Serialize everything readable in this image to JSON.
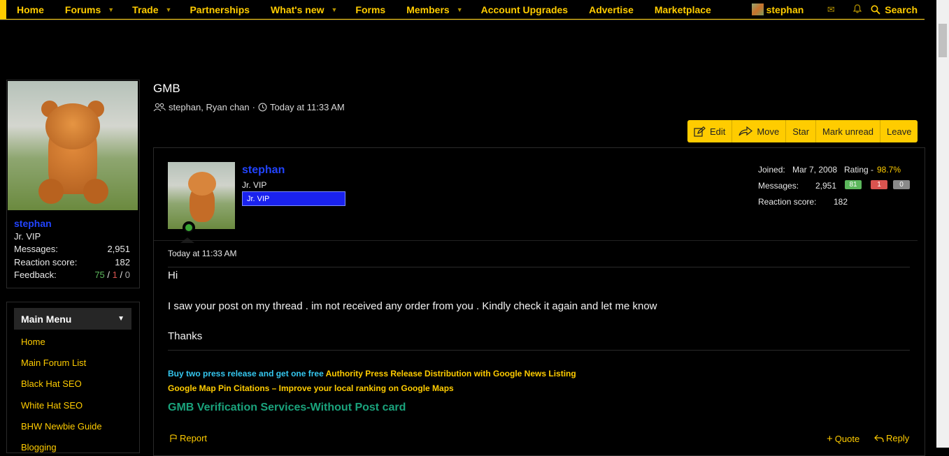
{
  "nav": {
    "items": [
      {
        "label": "Home",
        "caret": false
      },
      {
        "label": "Forums",
        "caret": true
      },
      {
        "label": "Trade",
        "caret": true
      },
      {
        "label": "Partnerships",
        "caret": false
      },
      {
        "label": "What's new",
        "caret": true
      },
      {
        "label": "Forms",
        "caret": false
      },
      {
        "label": "Members",
        "caret": true
      },
      {
        "label": "Account Upgrades",
        "caret": false
      },
      {
        "label": "Advertise",
        "caret": false
      },
      {
        "label": "Marketplace",
        "caret": false
      }
    ],
    "username": "stephan",
    "search_label": "Search"
  },
  "sidebar": {
    "user": {
      "name": "stephan",
      "title": "Jr. VIP",
      "messages_label": "Messages:",
      "messages_value": "2,951",
      "reaction_label": "Reaction score:",
      "reaction_value": "182",
      "feedback_label": "Feedback:",
      "feedback_pos": "75",
      "feedback_neg": "1",
      "feedback_neu": "0",
      "feedback_sep": "/"
    },
    "menu": {
      "title": "Main Menu",
      "items": [
        "Home",
        "Main Forum List",
        "Black Hat SEO",
        "White Hat SEO",
        "BHW Newbie Guide",
        "Blogging"
      ]
    }
  },
  "thread": {
    "title": "GMB",
    "participants": "stephan, Ryan chan",
    "separator": "·",
    "time": "Today at 11:33 AM",
    "buttons": [
      "Edit",
      "Move",
      "Star",
      "Mark unread",
      "Leave"
    ]
  },
  "post": {
    "username": "stephan",
    "user_title": "Jr. VIP",
    "banner": "Jr. VIP",
    "joined_label": "Joined:",
    "joined_value": "Mar 7, 2008",
    "rating_label": "Rating -",
    "rating_value": "98.7%",
    "messages_label": "Messages:",
    "messages_value": "2,951",
    "pill_pos": "81",
    "pill_neg": "1",
    "pill_neu": "0",
    "reaction_label": "Reaction score:",
    "reaction_value": "182",
    "time": "Today at 11:33 AM",
    "lines": [
      "Hi",
      "I saw your post on my thread . im not received any order from you . Kindly check it again and let me know",
      "Thanks"
    ],
    "signature": {
      "line1_a": "Buy two press release and get one free",
      "line1_b": "Authority Press Release Distribution with Google News Listing",
      "line2": "Google Map Pin Citations – Improve your local ranking on Google Maps",
      "line3": "GMB Verification Services-Without Post card"
    },
    "actions": {
      "report": "Report",
      "quote": "Quote",
      "reply": "Reply"
    }
  },
  "colors": {
    "accent": "#ffcc00",
    "username": "#2244ff",
    "background": "#000000"
  }
}
